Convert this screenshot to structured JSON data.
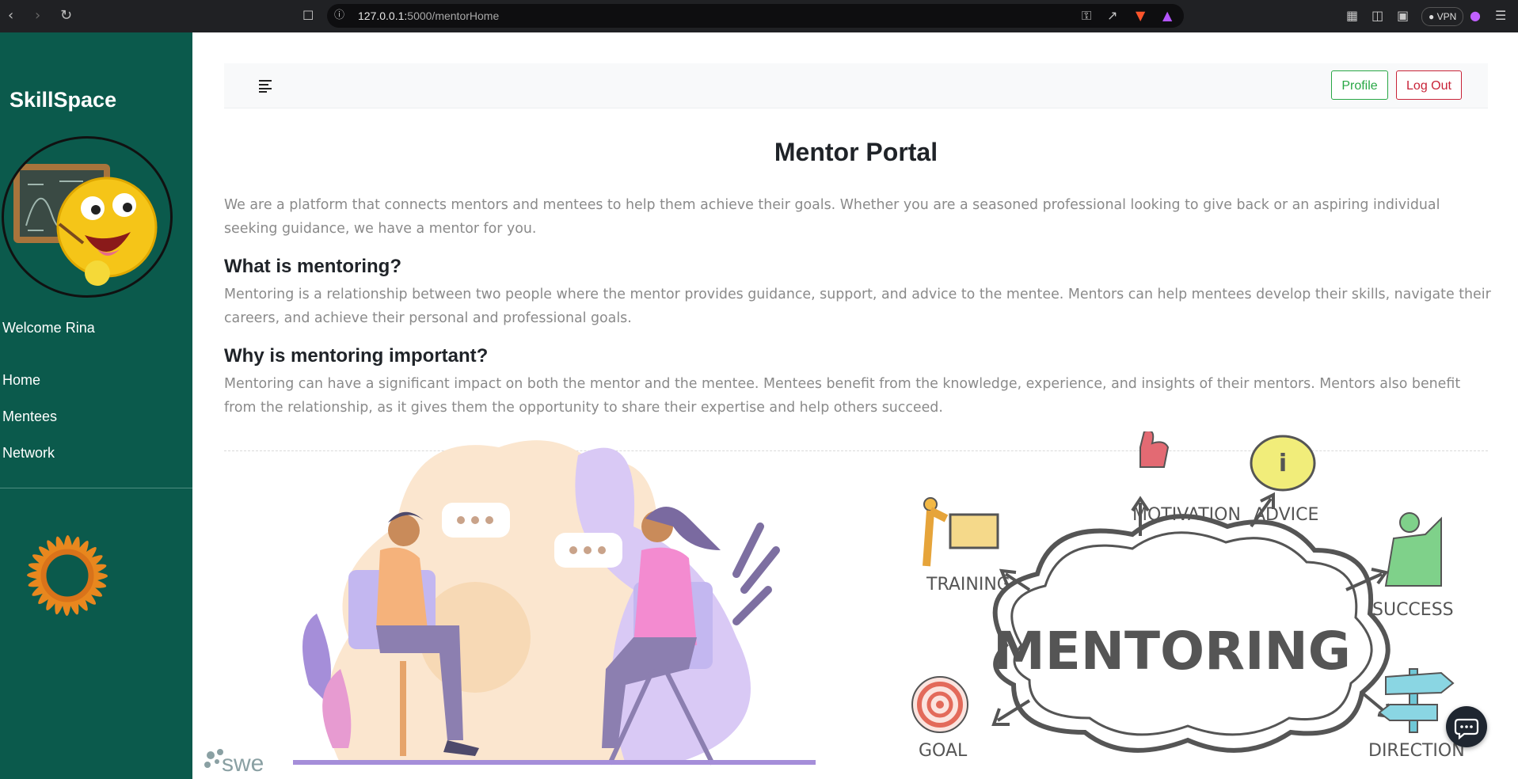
{
  "browser": {
    "url_host": "127.0.0.1:",
    "url_port_path": "5000/mentorHome",
    "vpn_label": "VPN"
  },
  "sidebar": {
    "brand": "SkillSpace",
    "welcome": "Welcome Rina",
    "items": [
      {
        "label": "Home"
      },
      {
        "label": "Mentees"
      },
      {
        "label": "Network"
      }
    ]
  },
  "topbar": {
    "profile_label": "Profile",
    "logout_label": "Log Out"
  },
  "main": {
    "title": "Mentor Portal",
    "intro": "We are a platform that connects mentors and mentees to help them achieve their goals. Whether you are a seasoned professional looking to give back or an aspiring individual seeking guidance, we have a mentor for you.",
    "sections": [
      {
        "heading": "What is mentoring?",
        "text": "Mentoring is a relationship between two people where the mentor provides guidance, support, and advice to the mentee. Mentors can help mentees develop their skills, navigate their careers, and achieve their personal and professional goals."
      },
      {
        "heading": "Why is mentoring important?",
        "text": "Mentoring can have a significant impact on both the mentor and the mentee. Mentees benefit from the knowledge, experience, and insights of their mentors. Mentors also benefit from the relationship, as it gives them the opportunity to share their expertise and help others succeed."
      }
    ]
  },
  "mentoring_graphic": {
    "center": "MENTORING",
    "labels": [
      "MOTIVATION",
      "ADVICE",
      "TRAINING",
      "SUCCESS",
      "GOAL",
      "DIRECTION"
    ]
  },
  "footer_logo": "swe",
  "colors": {
    "sidebar": "#0b5a4c",
    "profile": "#28a745",
    "logout": "#c82338"
  }
}
